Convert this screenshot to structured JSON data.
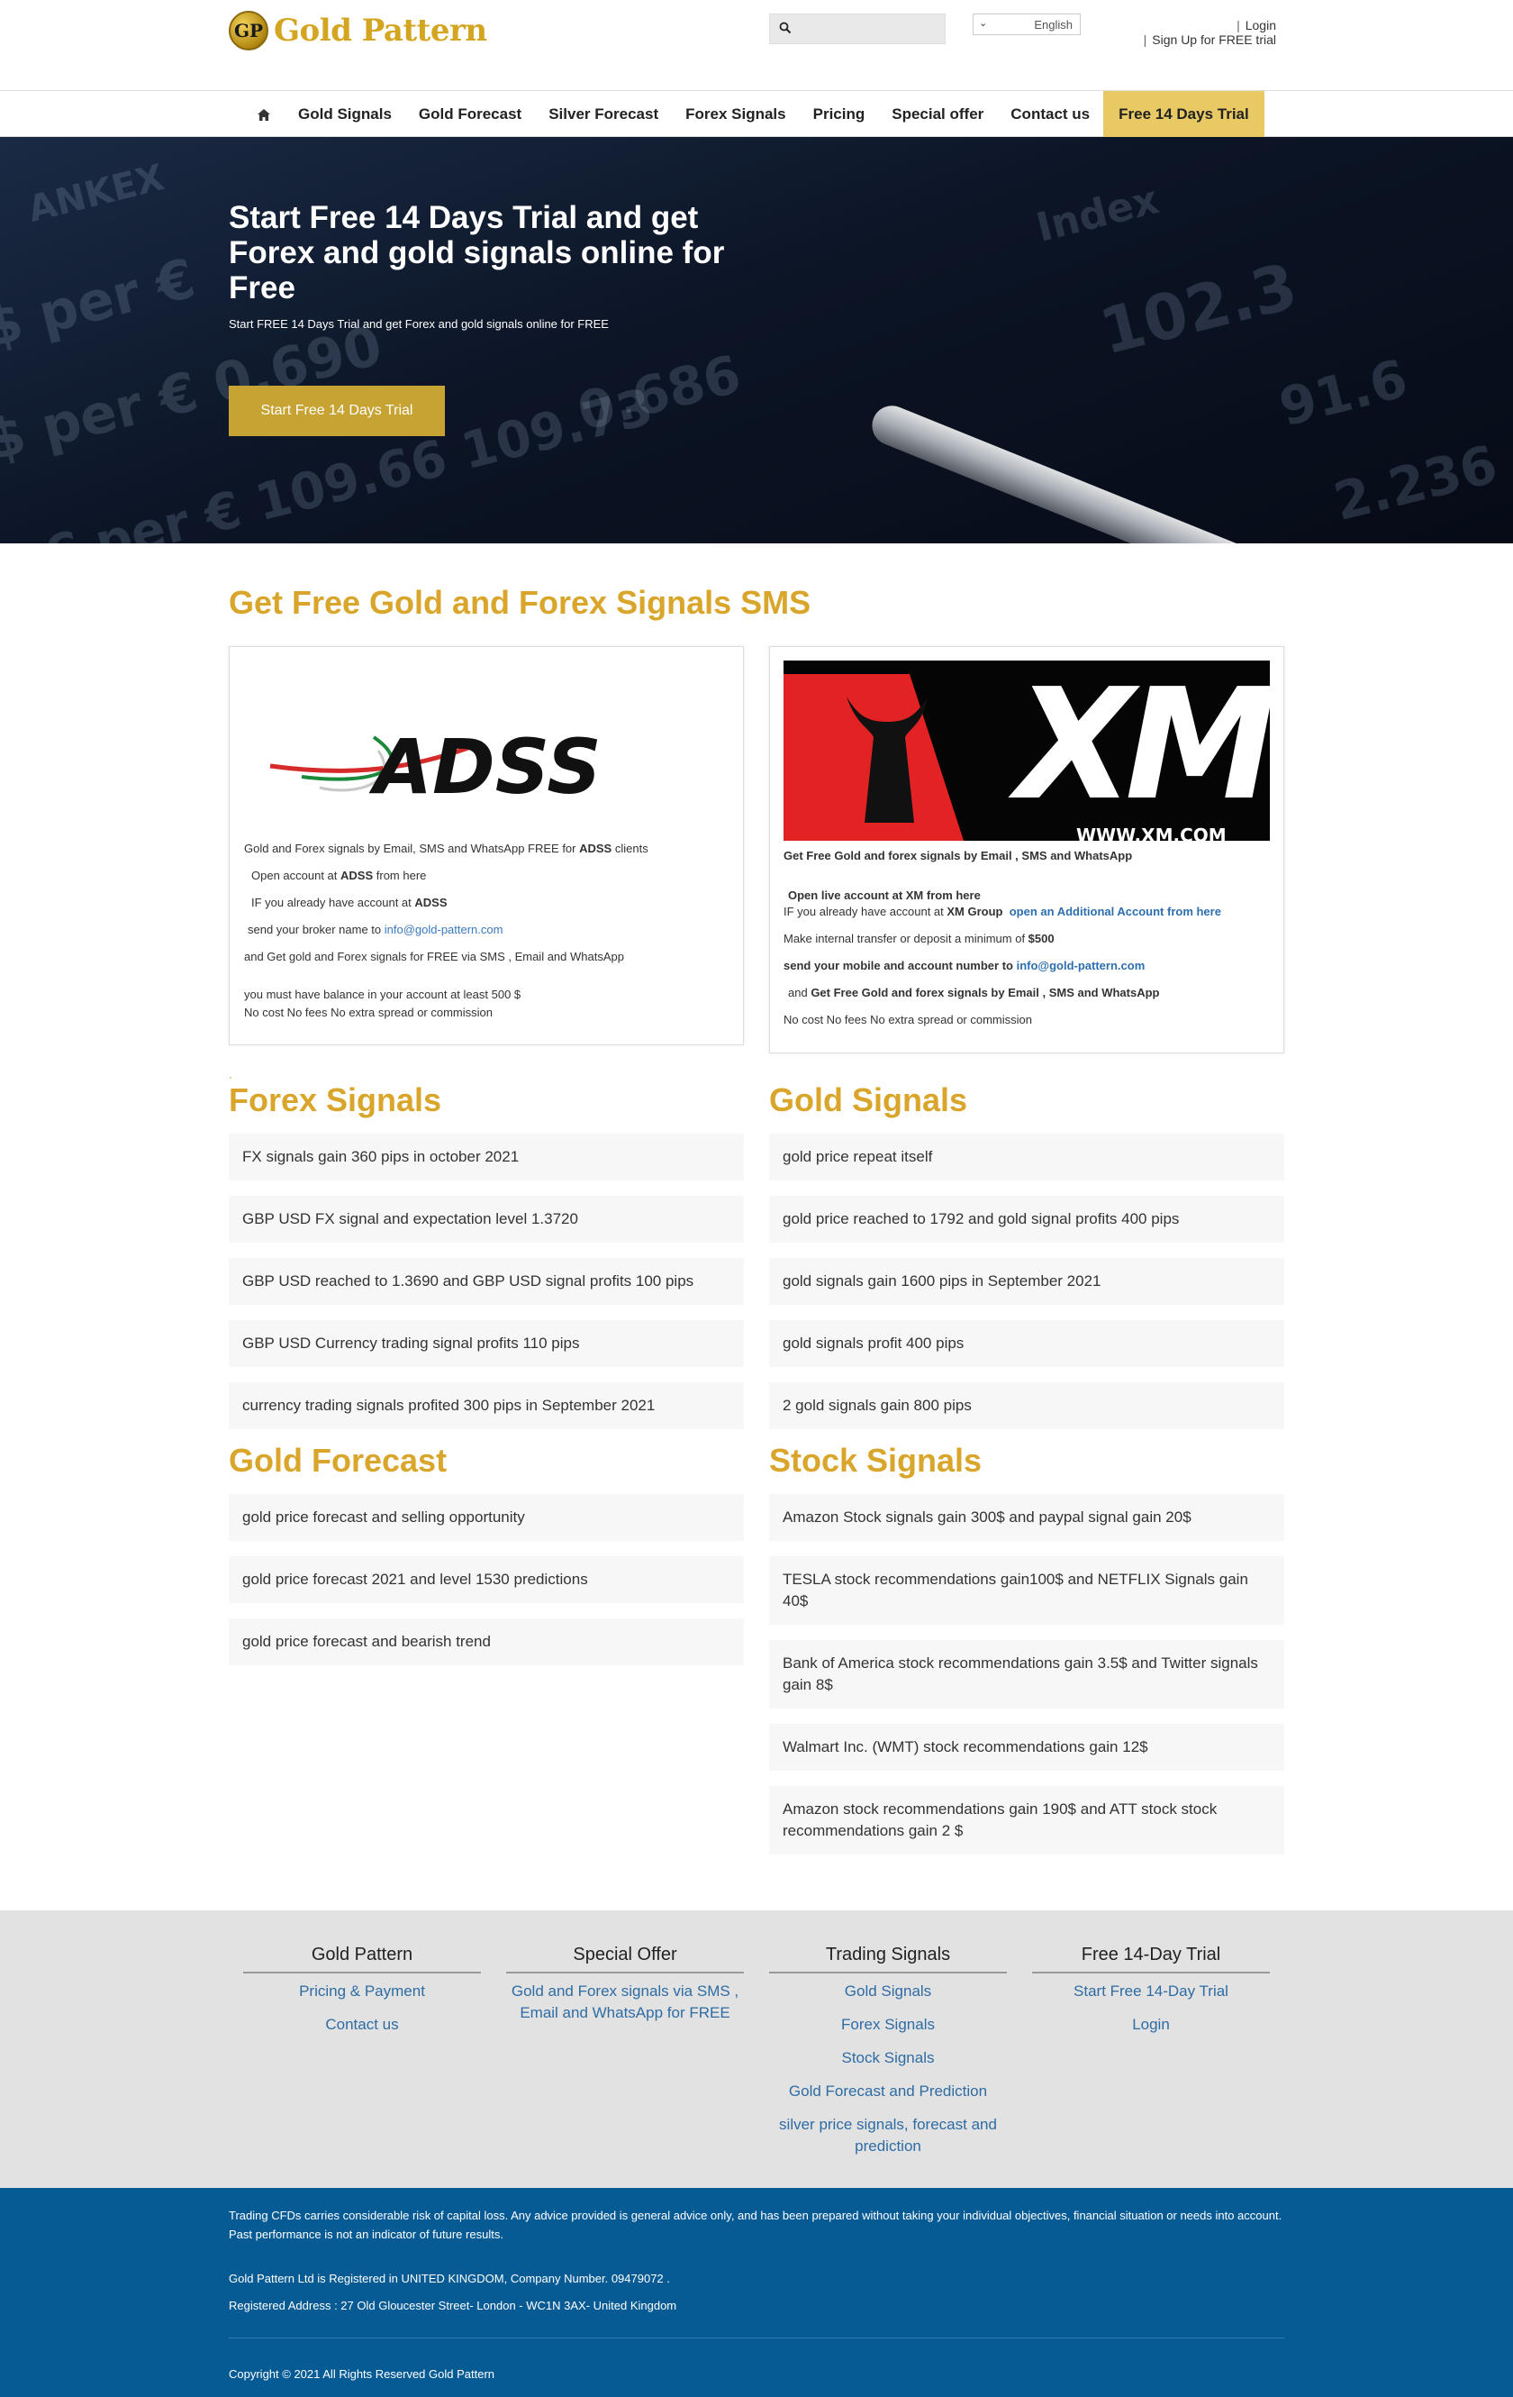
{
  "header": {
    "logo_badge": "GP",
    "logo_text": "Gold Pattern",
    "search": {
      "placeholder": "",
      "icon": "search-icon"
    },
    "language": "English",
    "login": "Login",
    "signup": "Sign Up for FREE trial"
  },
  "nav": {
    "home_icon": "home-icon",
    "items": [
      "Gold Signals",
      "Gold Forecast",
      "Silver Forecast",
      "Forex Signals",
      "Pricing",
      "Special offer",
      "Contact us"
    ],
    "cta": "Free 14 Days Trial"
  },
  "hero": {
    "title": "Start Free 14 Days Trial and get Forex and gold signals online for Free",
    "subtitle": "Start FREE 14 Days Trial and get Forex and gold signals online for FREE",
    "button": "Start Free 14 Days Trial"
  },
  "signals_section": {
    "heading": "Get Free Gold and Forex Signals SMS",
    "adss": {
      "logo_text": "ADSS",
      "line1_pre": "Gold and Forex signals by Email, SMS and WhatsApp FREE for ",
      "line1_bold": "ADSS",
      "line1_post": " clients",
      "line2_pre": "Open account at ",
      "line2_bold": "ADSS",
      "line2_post": " from here",
      "line3_pre": "IF you already have account at ",
      "line3_bold": "ADSS",
      "line4_pre": "send your broker name to ",
      "line4_email": "info@gold-pattern.com",
      "line5": "and Get gold and Forex signals for FREE via SMS , Email and WhatsApp",
      "line6": "you must have balance in your account at least 500 $",
      "line7": "No cost No fees No extra spread or commission"
    },
    "xm": {
      "banner_text": "XM",
      "banner_url": "WWW.XM.COM",
      "line1": "Get Free Gold and forex signals by Email , SMS and WhatsApp",
      "line2": "Open  live account at XM   from here",
      "line3_pre": "IF you already have account at ",
      "line3_bold": "XM Group",
      "line3_link": "open an Additional Account from here",
      "line4_pre": "Make internal transfer or deposit a minimum of ",
      "line4_bold": "$500",
      "line5_pre": "send  your mobile and account number to ",
      "line5_email": "info@gold-pattern.com",
      "line6_pre": "and ",
      "line6_bold": "Get Free Gold and forex signals by Email , SMS and WhatsApp",
      "line7": "No cost No fees No extra spread or commission"
    }
  },
  "forex_signals": {
    "heading": "Forex Signals",
    "posts": [
      "FX signals gain 360 pips in october 2021",
      "GBP USD FX signal and expectation level 1.3720",
      "GBP USD reached to 1.3690 and GBP USD signal profits 100 pips",
      "GBP USD Currency trading signal profits 110 pips",
      "currency trading signals profited 300 pips in September 2021"
    ]
  },
  "gold_signals": {
    "heading": "Gold Signals",
    "posts": [
      "gold price repeat itself",
      "gold price reached to 1792 and gold signal profits 400 pips",
      "gold signals gain 1600 pips in September 2021",
      "gold signals profit 400 pips",
      "2 gold signals gain 800 pips"
    ]
  },
  "gold_forecast": {
    "heading": "Gold Forecast",
    "posts": [
      "gold price forecast and selling opportunity",
      "gold price forecast 2021 and level 1530 predictions",
      "gold price forecast and bearish trend"
    ]
  },
  "stock_signals": {
    "heading": "Stock Signals",
    "posts": [
      "Amazon Stock signals gain 300$ and paypal signal gain 20$",
      "TESLA stock recommendations gain100$ and NETFLIX Signals gain 40$",
      "Bank of America stock recommendations gain 3.5$ and Twitter signals gain 8$",
      "Walmart Inc. (WMT) stock recommendations gain 12$",
      "Amazon stock recommendations gain 190$ and ATT stock stock recommendations gain 2 $"
    ]
  },
  "footer": {
    "columns": [
      {
        "title": "Gold Pattern",
        "links": [
          "Pricing & Payment",
          "Contact us"
        ]
      },
      {
        "title": "Special Offer",
        "links": [
          "Gold and Forex signals via SMS , Email and WhatsApp for FREE"
        ]
      },
      {
        "title": "Trading Signals",
        "links": [
          "Gold Signals",
          "Forex Signals",
          "Stock Signals",
          "Gold Forecast and Prediction",
          "silver price signals, forecast and prediction"
        ]
      },
      {
        "title": "Free 14-Day Trial",
        "links": [
          "Start Free 14-Day Trial",
          "Login"
        ]
      }
    ],
    "disclaimer": "Trading CFDs carries considerable risk of capital loss. Any advice provided is general advice only, and has been prepared without taking your individual objectives, financial situation or needs into account. Past performance is not an indicator of future results.",
    "company": "Gold Pattern Ltd is Registered in UNITED KINGDOM, Company Number. 09479072 .",
    "address": "Registered Address : 27 Old Gloucester Street- London - WC1N 3AX- United Kingdom",
    "copyright": "Copyright © 2021 All Rights Reserved Gold Pattern"
  },
  "colors": {
    "accent_gold": "#d9a52a",
    "cta_yellow": "#e9c963",
    "hero_button": "#c7a333",
    "footer_blue": "#065b94",
    "link_blue": "#2e6ca4"
  }
}
